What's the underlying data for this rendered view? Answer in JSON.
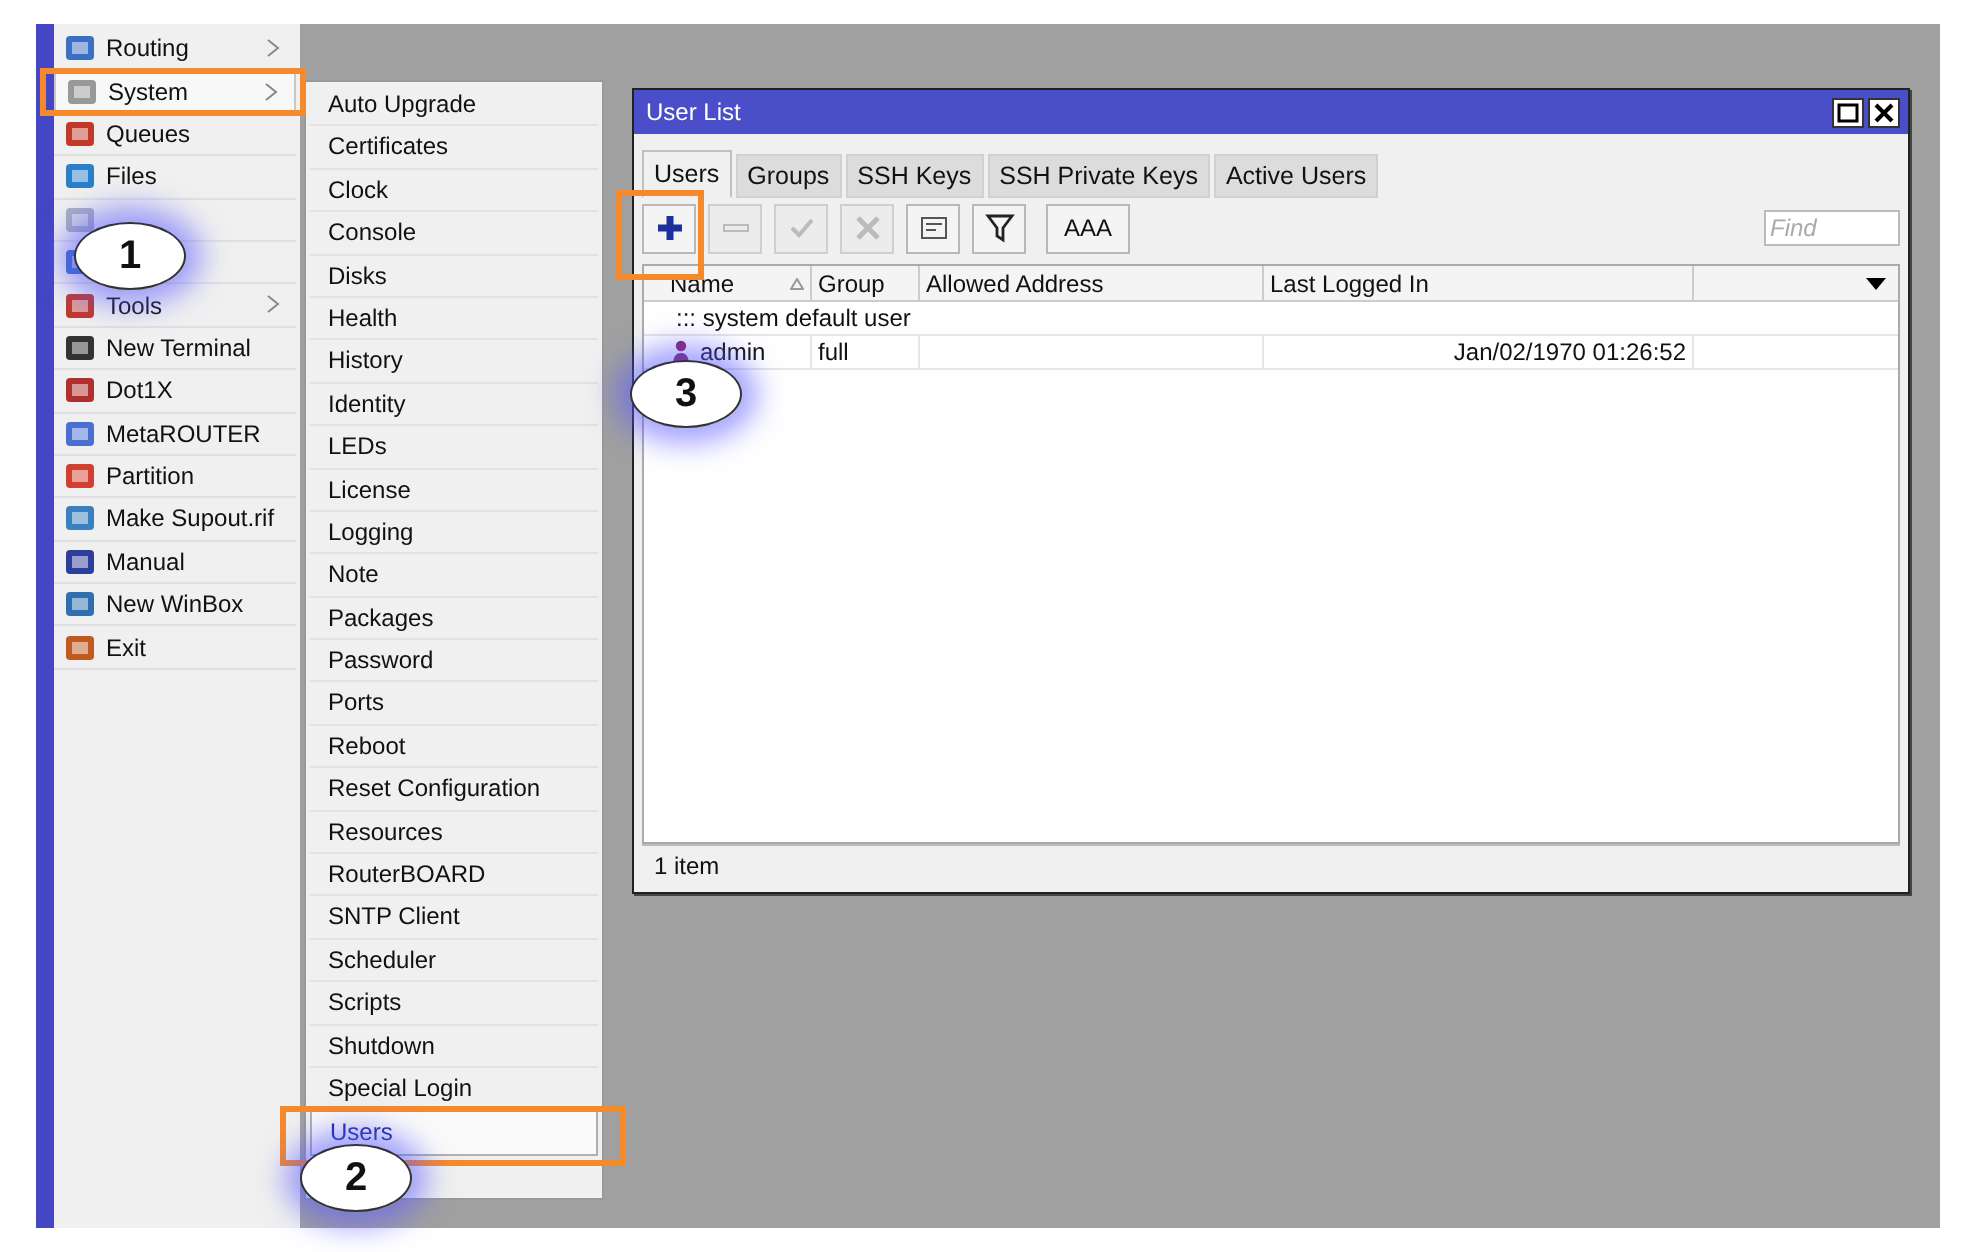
{
  "main_menu": {
    "items": [
      {
        "label": "Routing",
        "submenu": true,
        "selected": false
      },
      {
        "label": "System",
        "submenu": true,
        "selected": true
      },
      {
        "label": "Queues",
        "submenu": false,
        "selected": false
      },
      {
        "label": "Files",
        "submenu": false,
        "selected": false
      },
      {
        "submenu": false,
        "selected": false
      },
      {
        "submenu": false,
        "selected": false
      },
      {
        "label": "Tools",
        "submenu": true,
        "selected": false
      },
      {
        "label": "New Terminal",
        "submenu": false,
        "selected": false
      },
      {
        "label": "Dot1X",
        "submenu": false,
        "selected": false
      },
      {
        "label": "MetaROUTER",
        "submenu": false,
        "selected": false
      },
      {
        "label": "Partition",
        "submenu": false,
        "selected": false
      },
      {
        "label": "Make Supout.rif",
        "submenu": false,
        "selected": false
      },
      {
        "label": "Manual",
        "submenu": false,
        "selected": false
      },
      {
        "label": "New WinBox",
        "submenu": false,
        "selected": false
      },
      {
        "label": "Exit",
        "submenu": false,
        "selected": false
      }
    ]
  },
  "system_submenu": {
    "items": [
      {
        "label": "Auto Upgrade",
        "selected": false
      },
      {
        "label": "Certificates",
        "selected": false
      },
      {
        "label": "Clock",
        "selected": false
      },
      {
        "label": "Console",
        "selected": false
      },
      {
        "label": "Disks",
        "selected": false
      },
      {
        "label": "Health",
        "selected": false
      },
      {
        "label": "History",
        "selected": false
      },
      {
        "label": "Identity",
        "selected": false
      },
      {
        "label": "LEDs",
        "selected": false
      },
      {
        "label": "License",
        "selected": false
      },
      {
        "label": "Logging",
        "selected": false
      },
      {
        "label": "Note",
        "selected": false
      },
      {
        "label": "Packages",
        "selected": false
      },
      {
        "label": "Password",
        "selected": false
      },
      {
        "label": "Ports",
        "selected": false
      },
      {
        "label": "Reboot",
        "selected": false
      },
      {
        "label": "Reset Configuration",
        "selected": false
      },
      {
        "label": "Resources",
        "selected": false
      },
      {
        "label": "RouterBOARD",
        "selected": false
      },
      {
        "label": "SNTP Client",
        "selected": false
      },
      {
        "label": "Scheduler",
        "selected": false
      },
      {
        "label": "Scripts",
        "selected": false
      },
      {
        "label": "Shutdown",
        "selected": false
      },
      {
        "label": "Special Login",
        "selected": false
      },
      {
        "label": "Users",
        "selected": true
      }
    ]
  },
  "window": {
    "title": "User List",
    "tabs": [
      {
        "label": "Users",
        "selected": true
      },
      {
        "label": "Groups",
        "selected": false
      },
      {
        "label": "SSH Keys",
        "selected": false
      },
      {
        "label": "SSH Private Keys",
        "selected": false
      },
      {
        "label": "Active Users",
        "selected": false
      }
    ],
    "toolbar": {
      "buttons": [
        {
          "kind": "add",
          "disabled": false
        },
        {
          "kind": "remove",
          "disabled": true
        },
        {
          "kind": "enable",
          "disabled": true
        },
        {
          "kind": "disable",
          "disabled": true
        },
        {
          "kind": "comment",
          "disabled": false
        },
        {
          "kind": "filter",
          "disabled": false
        },
        {
          "kind": "text",
          "label": "AAA",
          "disabled": false
        }
      ],
      "search": {
        "placeholder": "Find"
      }
    },
    "table": {
      "columns": [
        {
          "label": "Name",
          "sorted": true
        },
        {
          "label": "Group",
          "sorted": false
        },
        {
          "label": "Allowed Address",
          "sorted": false
        },
        {
          "label": "Last Logged In",
          "sorted": false
        }
      ],
      "rows": [
        {
          "kind": "comment",
          "text": "::: system default user"
        },
        {
          "kind": "user",
          "name": "admin",
          "group": "full",
          "last_logged_in": "Jan/02/1970 01:26:52"
        }
      ]
    },
    "status_bar": "1 item"
  },
  "callouts": [
    {
      "label": "1"
    },
    {
      "label": "2"
    },
    {
      "label": "3"
    }
  ]
}
